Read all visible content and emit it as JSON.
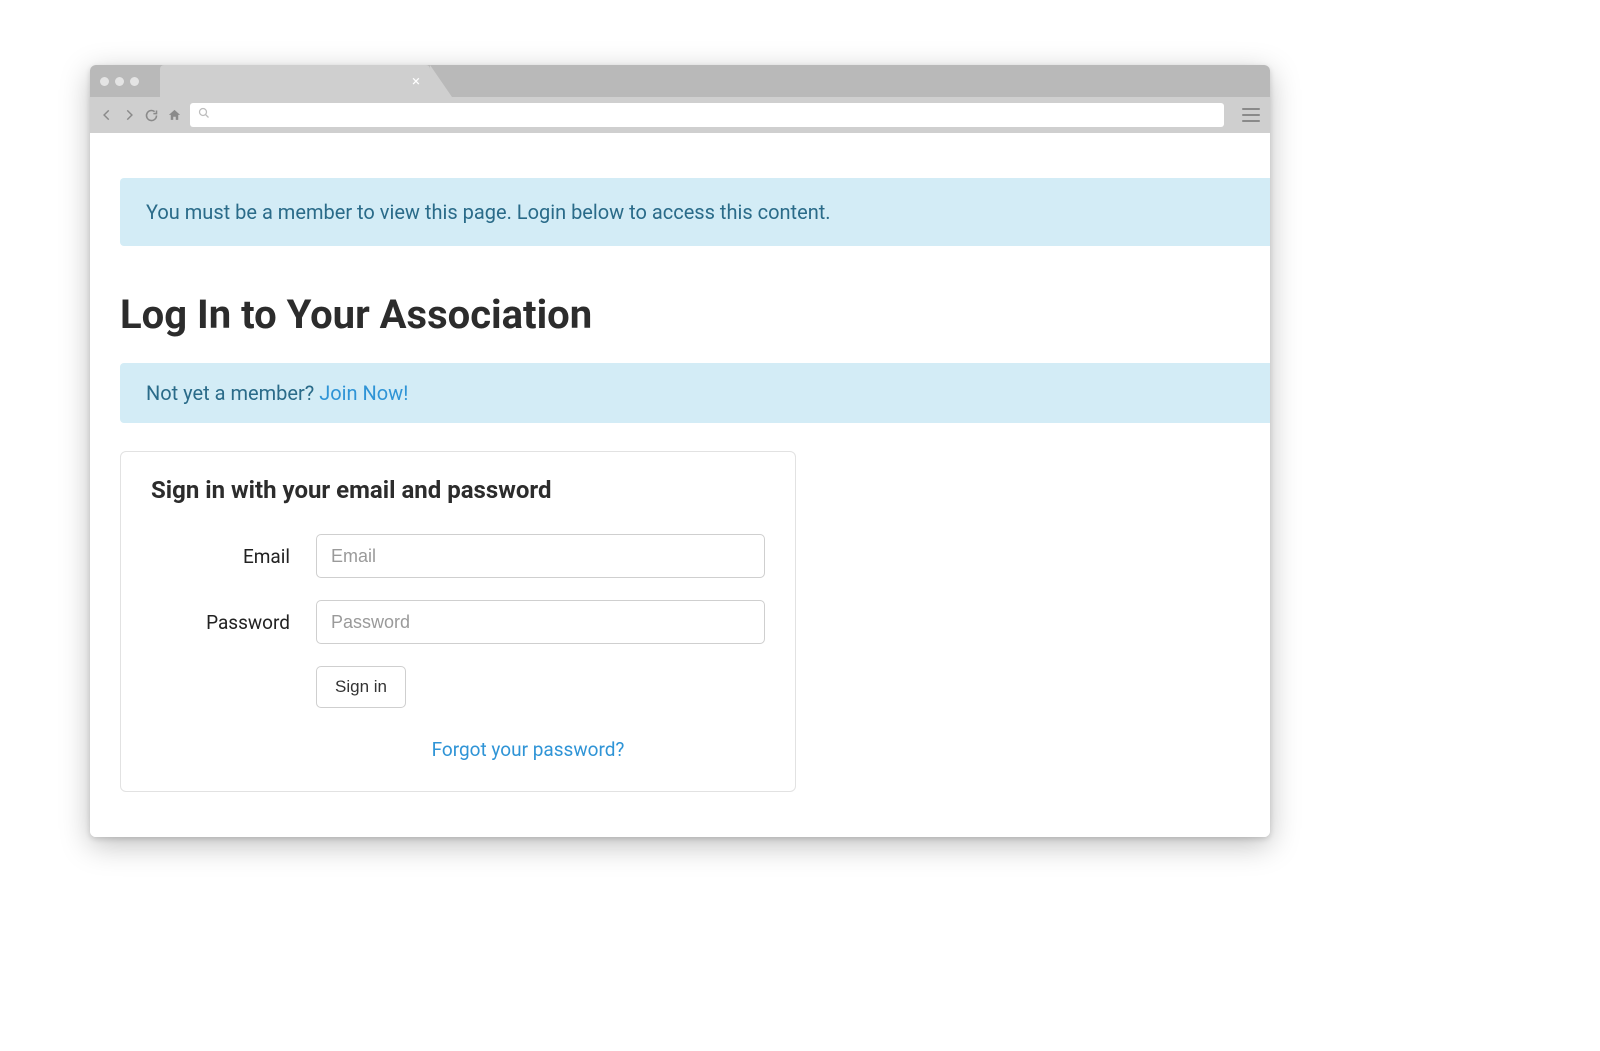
{
  "browser": {
    "tab_close_glyph": "×"
  },
  "alerts": {
    "member_required": "You must be a member to view this page. Login below to access this content."
  },
  "page": {
    "title": "Log In to Your Association"
  },
  "info": {
    "prefix": "Not yet a member? ",
    "join_link": "Join Now!"
  },
  "form": {
    "heading": "Sign in with your email and password",
    "email_label": "Email",
    "email_placeholder": "Email",
    "password_label": "Password",
    "password_placeholder": "Password",
    "submit_label": "Sign in",
    "forgot_label": "Forgot your password?"
  }
}
